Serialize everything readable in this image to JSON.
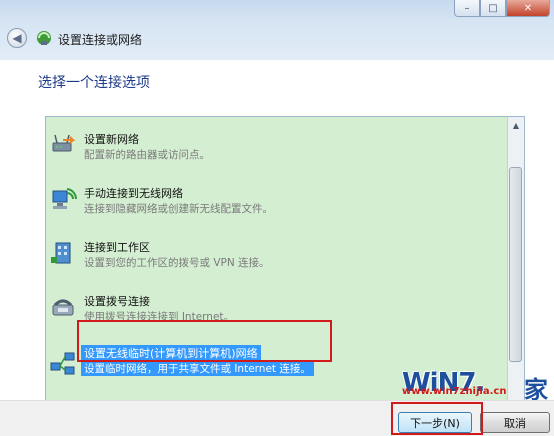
{
  "window": {
    "title": "设置连接或网络",
    "controls": {
      "minimize": "–",
      "maximize": "□",
      "close": "✕"
    }
  },
  "content": {
    "heading": "选择一个连接选项"
  },
  "options": [
    {
      "title": "设置新网络",
      "desc": "配置新的路由器或访问点。",
      "icon": "router-icon"
    },
    {
      "title": "手动连接到无线网络",
      "desc": "连接到隐藏网络或创建新无线配置文件。",
      "icon": "wireless-network-icon"
    },
    {
      "title": "连接到工作区",
      "desc": "设置到您的工作区的拨号或 VPN 连接。",
      "icon": "workplace-icon"
    },
    {
      "title": "设置拨号连接",
      "desc": "使用拨号连接连接到 Internet。",
      "icon": "dialup-modem-icon"
    },
    {
      "title": "设置无线临时(计算机到计算机)网络",
      "desc": "设置临时网络，用于共享文件或 Internet 连接。",
      "icon": "adhoc-network-icon",
      "selected": true
    }
  ],
  "buttons": {
    "next": "下一步(N)",
    "cancel": "取消"
  },
  "watermark": {
    "logo": "WiN7.",
    "url": "www.win7zhijia.cn",
    "jia": "家"
  },
  "colors": {
    "list_bg": "#d4eed2",
    "heading": "#1e3a8a",
    "selection": "#3399ff",
    "highlight_frame": "#d11a1a"
  }
}
